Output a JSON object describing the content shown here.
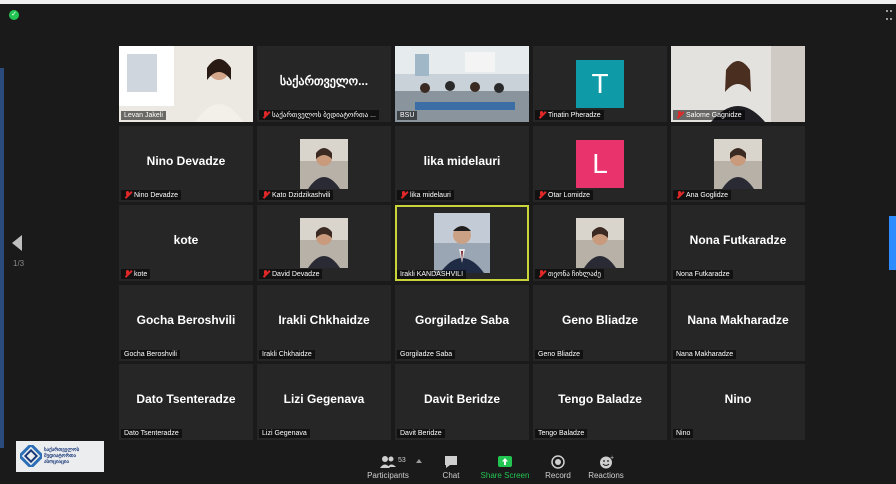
{
  "pager": {
    "text": "1/3"
  },
  "participants": [
    {
      "name": "",
      "label": "Levan Jakeli",
      "muted": false,
      "type": "video-room-woman"
    },
    {
      "name": "საქართველო...",
      "label": "საქართველოს ბედიატორთა ...",
      "muted": true,
      "type": "name"
    },
    {
      "name": "",
      "label": "BSU",
      "muted": false,
      "type": "video-classroom"
    },
    {
      "name": "",
      "label": "Tinatin Pheradze",
      "muted": true,
      "type": "avatar",
      "avatar_letter": "T",
      "avatar_color": "#0e9aa7"
    },
    {
      "name": "",
      "label": "Salome Gagnidze",
      "muted": true,
      "type": "video-woman"
    },
    {
      "name": "Nino Devadze",
      "label": "Nino Devadze",
      "muted": true,
      "type": "name"
    },
    {
      "name": "",
      "label": "Kato Dzidzikashvili",
      "muted": true,
      "type": "photo"
    },
    {
      "name": "lika midelauri",
      "label": "lika midelauri",
      "muted": true,
      "type": "name"
    },
    {
      "name": "",
      "label": "Otar Lomidze",
      "muted": true,
      "type": "avatar",
      "avatar_letter": "L",
      "avatar_color": "#e8336d"
    },
    {
      "name": "",
      "label": "Ana Goglidze",
      "muted": true,
      "type": "photo"
    },
    {
      "name": "kote",
      "label": "kote",
      "muted": true,
      "type": "name"
    },
    {
      "name": "",
      "label": "David Devadze",
      "muted": true,
      "type": "photo"
    },
    {
      "name": "",
      "label": "Irakli KANDASHVILI",
      "muted": false,
      "type": "video-man",
      "active": true
    },
    {
      "name": "",
      "label": "თეონა ჩიხლაძე",
      "muted": true,
      "type": "photo"
    },
    {
      "name": "Nona Futkaradze",
      "label": "Nona Futkaradze",
      "muted": false,
      "type": "name"
    },
    {
      "name": "Gocha Beroshvili",
      "label": "Gocha Beroshvili",
      "muted": false,
      "type": "name"
    },
    {
      "name": "Irakli Chkhaidze",
      "label": "Irakli Chkhaidze",
      "muted": false,
      "type": "name"
    },
    {
      "name": "Gorgiladze Saba",
      "label": "Gorgiladze Saba",
      "muted": false,
      "type": "name"
    },
    {
      "name": "Geno Bliadze",
      "label": "Geno Bliadze",
      "muted": false,
      "type": "name"
    },
    {
      "name": "Nana Makharadze",
      "label": "Nana Makharadze",
      "muted": false,
      "type": "name"
    },
    {
      "name": "Dato Tsenteradze",
      "label": "Dato Tsenteradze",
      "muted": false,
      "type": "name"
    },
    {
      "name": "Lizi Gegenava",
      "label": "Lizi Gegenava",
      "muted": false,
      "type": "name"
    },
    {
      "name": "Davit Beridze",
      "label": "Davit Beridze",
      "muted": false,
      "type": "name"
    },
    {
      "name": "Tengo Baladze",
      "label": "Tengo Baladze",
      "muted": false,
      "type": "name"
    },
    {
      "name": "Nino",
      "label": "Nino",
      "muted": false,
      "type": "name"
    }
  ],
  "toolbar": {
    "participants_label": "Participants",
    "participants_count": "53",
    "chat_label": "Chat",
    "share_label": "Share Screen",
    "record_label": "Record",
    "reactions_label": "Reactions"
  },
  "logo": {
    "text": "საქართველოს მედიატორთა ასოციაცია"
  },
  "colors": {
    "background": "#1a1a1a",
    "tile": "#262626",
    "active_border": "#c8d43a",
    "share_green": "#23c552",
    "muted_red": "#e02828",
    "accent_blue": "#2d8cff"
  }
}
